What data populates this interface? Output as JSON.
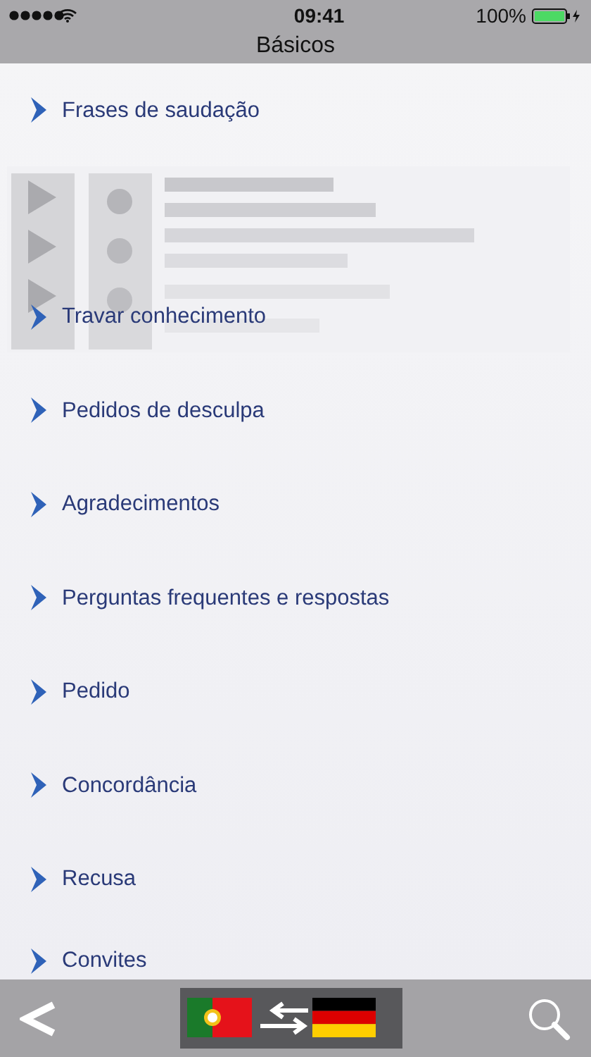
{
  "status_bar": {
    "time": "09:41",
    "battery": "100%"
  },
  "title": "Básicos",
  "items": [
    {
      "label": "Frases de saudação"
    },
    {
      "label": "Travar conhecimento"
    },
    {
      "label": "Pedidos de desculpa"
    },
    {
      "label": "Agradecimentos"
    },
    {
      "label": "Perguntas frequentes e respostas"
    },
    {
      "label": "Pedido"
    },
    {
      "label": "Concordância"
    },
    {
      "label": "Recusa"
    },
    {
      "label": "Convites"
    }
  ]
}
